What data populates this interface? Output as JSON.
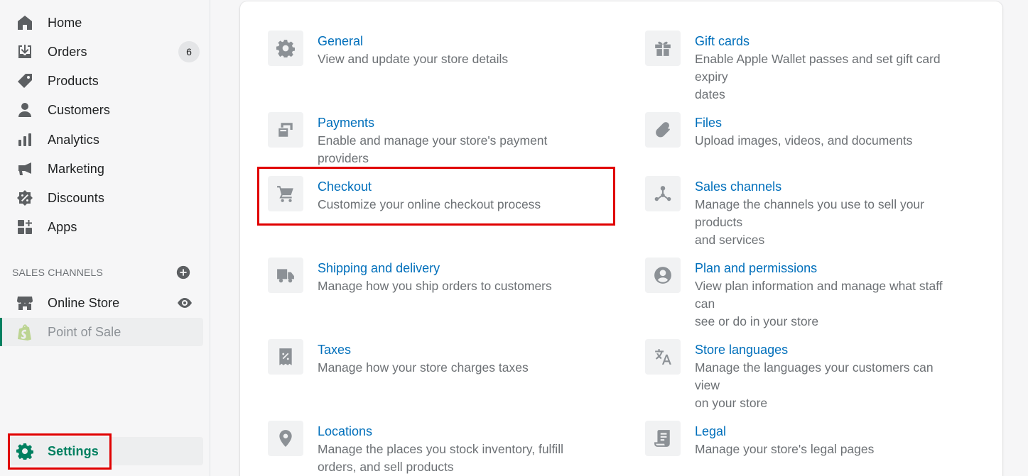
{
  "sidebar": {
    "nav": [
      {
        "label": "Home",
        "icon": "home-icon"
      },
      {
        "label": "Orders",
        "icon": "orders-icon",
        "badge": "6"
      },
      {
        "label": "Products",
        "icon": "tag-icon"
      },
      {
        "label": "Customers",
        "icon": "person-icon"
      },
      {
        "label": "Analytics",
        "icon": "bar-chart-icon"
      },
      {
        "label": "Marketing",
        "icon": "megaphone-icon"
      },
      {
        "label": "Discounts",
        "icon": "discount-icon"
      },
      {
        "label": "Apps",
        "icon": "apps-icon"
      }
    ],
    "sales_channels_title": "SALES CHANNELS",
    "channels": [
      {
        "label": "Online Store",
        "icon": "store-icon"
      },
      {
        "label": "Point of Sale",
        "icon": "shopify-bag-icon"
      }
    ],
    "settings_label": "Settings"
  },
  "settings": {
    "left": [
      {
        "title": "General",
        "desc": [
          "View and update your store details"
        ],
        "icon": "gear-icon"
      },
      {
        "title": "Payments",
        "desc": [
          "Enable and manage your store's payment providers"
        ],
        "icon": "payment-icon"
      },
      {
        "title": "Checkout",
        "desc": [
          "Customize your online checkout process"
        ],
        "icon": "cart-icon"
      },
      {
        "title": "Shipping and delivery",
        "desc": [
          "Manage how you ship orders to customers"
        ],
        "icon": "truck-icon"
      },
      {
        "title": "Taxes",
        "desc": [
          "Manage how your store charges taxes"
        ],
        "icon": "tax-receipt-icon"
      },
      {
        "title": "Locations",
        "desc": [
          "Manage the places you stock inventory, fulfill",
          "orders, and sell products"
        ],
        "icon": "location-pin-icon"
      }
    ],
    "right": [
      {
        "title": "Gift cards",
        "desc": [
          "Enable Apple Wallet passes and set gift card expiry",
          "dates"
        ],
        "icon": "gift-icon"
      },
      {
        "title": "Files",
        "desc": [
          "Upload images, videos, and documents"
        ],
        "icon": "paperclip-icon"
      },
      {
        "title": "Sales channels",
        "desc": [
          "Manage the channels you use to sell your products",
          "and services"
        ],
        "icon": "channels-icon"
      },
      {
        "title": "Plan and permissions",
        "desc": [
          "View plan information and manage what staff can",
          "see or do in your store"
        ],
        "icon": "user-circle-icon"
      },
      {
        "title": "Store languages",
        "desc": [
          "Manage the languages your customers can view",
          "on your store"
        ],
        "icon": "translate-icon"
      },
      {
        "title": "Legal",
        "desc": [
          "Manage your store's legal pages"
        ],
        "icon": "legal-scroll-icon"
      }
    ]
  },
  "colors": {
    "accent_green": "#008060",
    "link_blue": "#006fbb",
    "highlight_red": "#e00000"
  }
}
